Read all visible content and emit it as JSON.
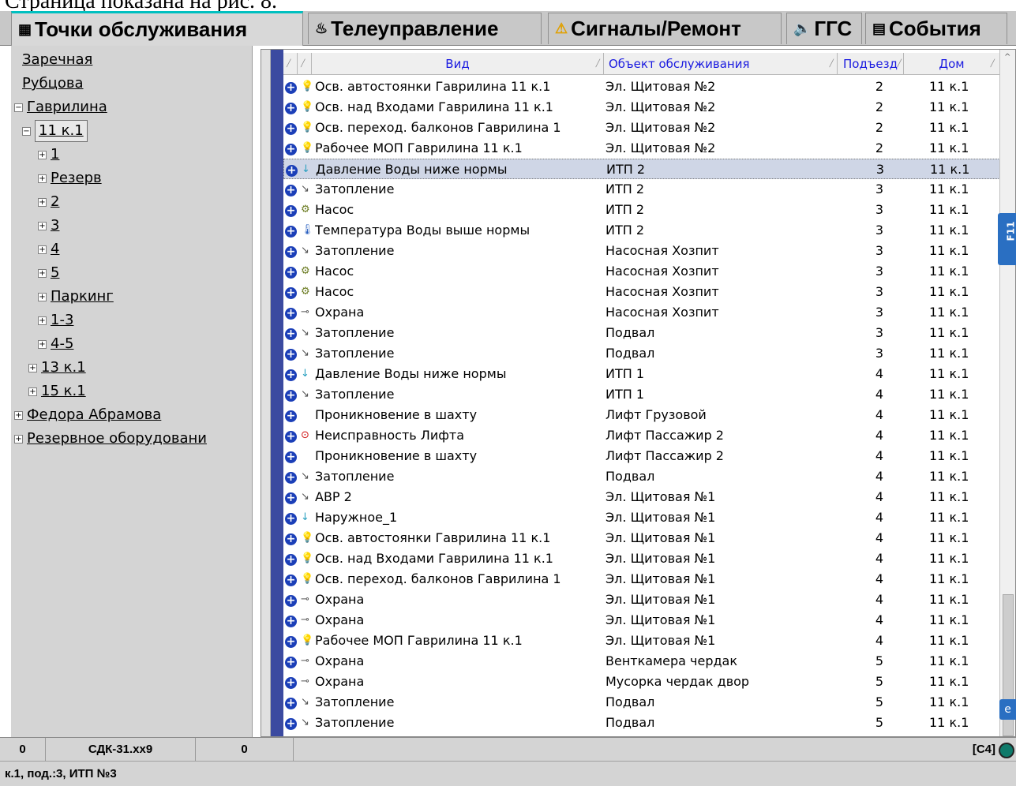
{
  "document_caption": "Страница показана на рис. 8.",
  "tabs": [
    {
      "icon": "▦",
      "label": "Точки обслуживания",
      "active": true
    },
    {
      "icon": "♨",
      "label": "Телеуправление",
      "active": false
    },
    {
      "icon": "⚠",
      "label": "Сигналы/Ремонт",
      "active": false
    },
    {
      "icon": "🔈",
      "label": "ГГС",
      "active": false
    },
    {
      "icon": "▤",
      "label": "События",
      "active": false
    }
  ],
  "tree": [
    {
      "label": "Заречная",
      "expander": ""
    },
    {
      "label": "Рубцова",
      "expander": ""
    },
    {
      "label": "Гаврилина",
      "expander": "−"
    },
    {
      "label": "11 к.1",
      "expander": "−",
      "selected": true
    },
    {
      "label": "1",
      "expander": "+"
    },
    {
      "label": "Резерв",
      "expander": "+"
    },
    {
      "label": "2",
      "expander": "+"
    },
    {
      "label": "3",
      "expander": "+"
    },
    {
      "label": "4",
      "expander": "+"
    },
    {
      "label": "5",
      "expander": "+"
    },
    {
      "label": "Паркинг",
      "expander": "+"
    },
    {
      "label": "1-3",
      "expander": "+"
    },
    {
      "label": "4-5",
      "expander": "+"
    },
    {
      "label": "13 к.1",
      "expander": "+"
    },
    {
      "label": "15 к.1",
      "expander": "+"
    },
    {
      "label": "Федора Абрамова",
      "expander": "+"
    },
    {
      "label": " Резервное оборудовани",
      "expander": "+"
    }
  ],
  "grid": {
    "headers": {
      "vid": "Вид",
      "obj": "Объект обслуживания",
      "pod": "Подъезд",
      "dom": "Дом"
    },
    "rows": [
      {
        "icon": "💡",
        "vid": "Осв. автостоянки Гаврилина 11 к.1",
        "obj": "Эл. Щитовая №2",
        "pod": "2",
        "dom": "11 к.1"
      },
      {
        "icon": "💡",
        "vid": "Осв. над Входами Гаврилина 11 к.1",
        "obj": "Эл. Щитовая №2",
        "pod": "2",
        "dom": "11 к.1"
      },
      {
        "icon": "💡",
        "vid": "Осв. переход. балконов Гаврилина 1",
        "obj": "Эл. Щитовая №2",
        "pod": "2",
        "dom": "11 к.1"
      },
      {
        "icon": "💡",
        "vid": "Рабочее МОП Гаврилина 11 к.1",
        "obj": "Эл. Щитовая №2",
        "pod": "2",
        "dom": "11 к.1"
      },
      {
        "icon": "↓",
        "vid": "Давление Воды ниже нормы",
        "obj": "ИТП 2",
        "pod": "3",
        "dom": "11 к.1",
        "highlight": true
      },
      {
        "icon": "↘",
        "vid": "Затопление",
        "obj": "ИТП 2",
        "pod": "3",
        "dom": "11 к.1"
      },
      {
        "icon": "⚙",
        "vid": "Насос",
        "obj": "ИТП 2",
        "pod": "3",
        "dom": "11 к.1"
      },
      {
        "icon": "🌡",
        "vid": "Температура Воды выше нормы",
        "obj": "ИТП 2",
        "pod": "3",
        "dom": "11 к.1"
      },
      {
        "icon": "↘",
        "vid": "Затопление",
        "obj": "Насосная Хозпит",
        "pod": "3",
        "dom": "11 к.1"
      },
      {
        "icon": "⚙",
        "vid": "Насос",
        "obj": "Насосная Хозпит",
        "pod": "3",
        "dom": "11 к.1"
      },
      {
        "icon": "⚙",
        "vid": "Насос",
        "obj": "Насосная Хозпит",
        "pod": "3",
        "dom": "11 к.1"
      },
      {
        "icon": "⊸",
        "vid": "Охрана",
        "obj": "Насосная Хозпит",
        "pod": "3",
        "dom": "11 к.1"
      },
      {
        "icon": "↘",
        "vid": "Затопление",
        "obj": "Подвал",
        "pod": "3",
        "dom": "11 к.1"
      },
      {
        "icon": "↘",
        "vid": "Затопление",
        "obj": "Подвал",
        "pod": "3",
        "dom": "11 к.1"
      },
      {
        "icon": "↓",
        "vid": "Давление Воды ниже нормы",
        "obj": "ИТП 1",
        "pod": "4",
        "dom": "11 к.1"
      },
      {
        "icon": "↘",
        "vid": "Затопление",
        "obj": "ИТП 1",
        "pod": "4",
        "dom": "11 к.1"
      },
      {
        "icon": "",
        "vid": "Проникновение в шахту",
        "obj": "Лифт Грузовой",
        "pod": "4",
        "dom": "11 к.1"
      },
      {
        "icon": "⊙",
        "vid": "Неисправность Лифта",
        "obj": "Лифт Пассажир 2",
        "pod": "4",
        "dom": "11 к.1"
      },
      {
        "icon": "",
        "vid": "Проникновение в шахту",
        "obj": "Лифт Пассажир 2",
        "pod": "4",
        "dom": "11 к.1"
      },
      {
        "icon": "↘",
        "vid": "Затопление",
        "obj": "Подвал",
        "pod": "4",
        "dom": "11 к.1"
      },
      {
        "icon": "↘",
        "vid": "АВР 2",
        "obj": "Эл. Щитовая №1",
        "pod": "4",
        "dom": "11 к.1"
      },
      {
        "icon": "↓",
        "vid": "Наружное_1",
        "obj": "Эл. Щитовая №1",
        "pod": "4",
        "dom": "11 к.1"
      },
      {
        "icon": "💡",
        "vid": "Осв. автостоянки Гаврилина 11 к.1",
        "obj": "Эл. Щитовая №1",
        "pod": "4",
        "dom": "11 к.1"
      },
      {
        "icon": "💡",
        "vid": "Осв. над Входами Гаврилина 11 к.1",
        "obj": "Эл. Щитовая №1",
        "pod": "4",
        "dom": "11 к.1"
      },
      {
        "icon": "💡",
        "vid": "Осв. переход. балконов Гаврилина 1",
        "obj": "Эл. Щитовая №1",
        "pod": "4",
        "dom": "11 к.1"
      },
      {
        "icon": "⊸",
        "vid": "Охрана",
        "obj": "Эл. Щитовая №1",
        "pod": "4",
        "dom": "11 к.1"
      },
      {
        "icon": "⊸",
        "vid": "Охрана",
        "obj": "Эл. Щитовая №1",
        "pod": "4",
        "dom": "11 к.1"
      },
      {
        "icon": "💡",
        "vid": "Рабочее МОП Гаврилина 11 к.1",
        "obj": "Эл. Щитовая №1",
        "pod": "4",
        "dom": "11 к.1"
      },
      {
        "icon": "⊸",
        "vid": "Охрана",
        "obj": "Венткамера чердак",
        "pod": "5",
        "dom": "11 к.1"
      },
      {
        "icon": "⊸",
        "vid": "Охрана",
        "obj": "Мусорка чердак двор",
        "pod": "5",
        "dom": "11 к.1"
      },
      {
        "icon": "↘",
        "vid": "Затопление",
        "obj": "Подвал",
        "pod": "5",
        "dom": "11 к.1"
      },
      {
        "icon": "↘",
        "vid": "Затопление",
        "obj": "Подвал",
        "pod": "5",
        "dom": "11 к.1"
      }
    ]
  },
  "side_gadget": {
    "label": "F11",
    "icon": "e"
  },
  "statusbar": {
    "cell1": "0",
    "cell2": "СДК-31.xx9",
    "cell3": "0",
    "right": "[C4]"
  },
  "infobar": {
    "text": "к.1, под.:3, ИТП №3"
  },
  "colors": {
    "accent_tab": "#00c0c0",
    "row_highlight": "#cfd6e6",
    "plus_button": "#1b3fb8",
    "header_text": "#1a1ae0"
  }
}
